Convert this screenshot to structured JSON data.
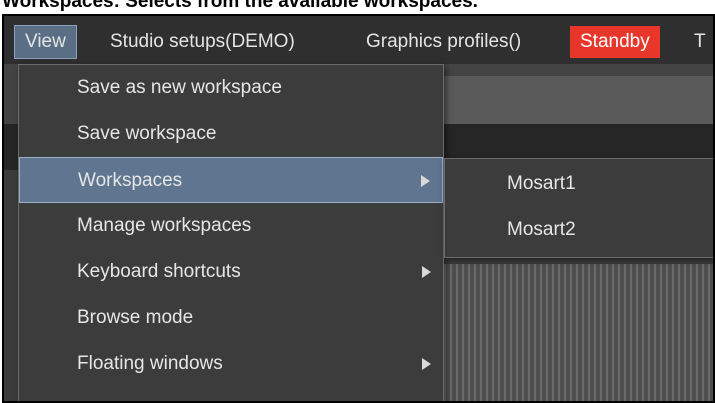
{
  "caption": "Workspaces: Selects from the available workspaces.",
  "menubar": {
    "items": [
      "View",
      "Studio setups(DEMO)",
      "Graphics profiles()",
      "Standby",
      "T"
    ]
  },
  "colors": {
    "view_active": "#5a6e86",
    "standby": "#e8372a",
    "menu_bg": "#3c3c3c",
    "highlight": "#5f7590"
  },
  "view_menu": {
    "items": [
      {
        "label": "Save as new workspace",
        "submenu": false
      },
      {
        "label": "Save workspace",
        "submenu": false
      },
      {
        "label": "Workspaces",
        "submenu": true
      },
      {
        "label": "Manage workspaces",
        "submenu": false
      },
      {
        "label": "Keyboard shortcuts",
        "submenu": true
      },
      {
        "label": "Browse mode",
        "submenu": false
      },
      {
        "label": "Floating windows",
        "submenu": true
      }
    ],
    "active_item": "Workspaces"
  },
  "workspaces_submenu": {
    "items": [
      "Mosart1",
      "Mosart2"
    ]
  }
}
